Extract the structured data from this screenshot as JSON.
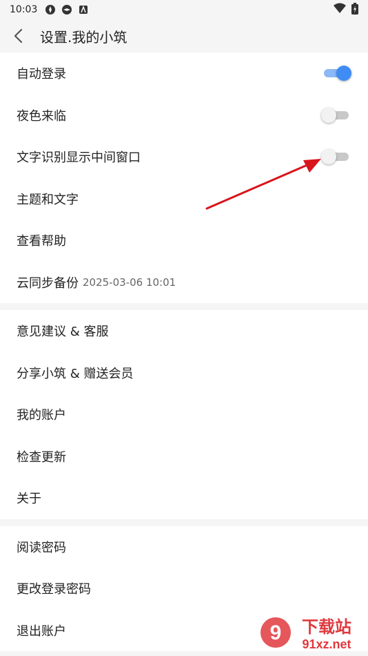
{
  "status": {
    "time": "10:03"
  },
  "header": {
    "title": "设置.我的小筑"
  },
  "group1": [
    {
      "label": "自动登录",
      "toggle": "on"
    },
    {
      "label": "夜色来临",
      "toggle": "off"
    },
    {
      "label": "文字识别显示中间窗口",
      "toggle": "off"
    },
    {
      "label": "主题和文字"
    },
    {
      "label": "查看帮助"
    },
    {
      "label": "云同步备份",
      "sub": "2025-03-06 10:01"
    }
  ],
  "group2": [
    {
      "label": "意见建议 & 客服"
    },
    {
      "label": "分享小筑 & 赠送会员"
    },
    {
      "label": "我的账户"
    },
    {
      "label": "检查更新"
    },
    {
      "label": "关于"
    }
  ],
  "group3": [
    {
      "label": "阅读密码"
    },
    {
      "label": "更改登录密码"
    },
    {
      "label": "退出账户"
    }
  ],
  "watermark": {
    "top": "下载站",
    "bottom": "91xz.net",
    "mark": "9"
  },
  "colors": {
    "accent": "#3f8cf4",
    "arrow": "#d8141c",
    "watermark": "#e0393e"
  }
}
